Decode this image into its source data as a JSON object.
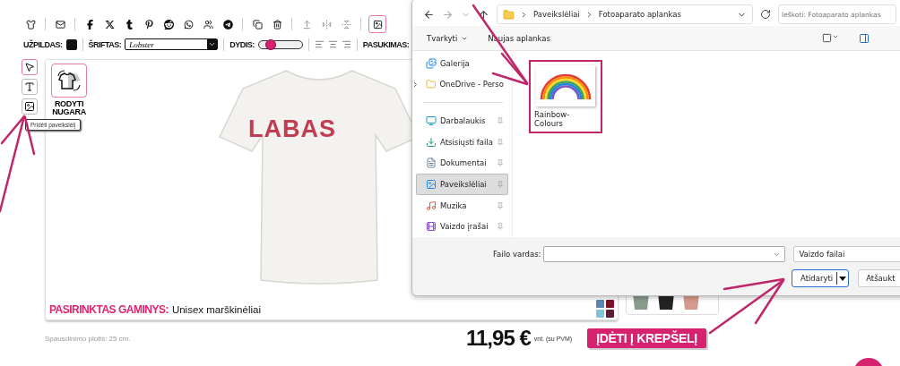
{
  "toolbar": {
    "groups": [
      {
        "items": [
          {
            "selected": false
          }
        ]
      },
      {
        "items": [
          {
            "selected": false
          }
        ]
      },
      {
        "items": [
          {
            "selected": false
          },
          {
            "selected": false
          },
          {
            "selected": false
          },
          {
            "selected": false
          },
          {
            "selected": false
          },
          {
            "selected": false
          },
          {
            "selected": false
          },
          {
            "selected": false
          }
        ]
      },
      {
        "items": [
          {
            "selected": false
          },
          {
            "selected": false
          }
        ]
      },
      {
        "items": [
          {
            "selected": false
          },
          {
            "selected": false
          },
          {
            "selected": false
          }
        ]
      },
      {
        "items": [
          {
            "selected": true
          }
        ]
      }
    ]
  },
  "properties": {
    "fill_label": "UŽPILDAS:",
    "font_label": "ŠRIFTAS:",
    "font_value": "Lobster",
    "size_label": "DYDIS:",
    "size_slider": {
      "level": 0.27
    },
    "rotation_label": "PASUKIMAS:"
  },
  "tools": [
    {
      "selected": true
    },
    {
      "selected": false
    },
    {
      "selected": false
    }
  ],
  "tooltip": "Pridėti paveikslėlį",
  "show_back": {
    "label": "RODYTI NUGARA"
  },
  "shirt_print": "LABAS",
  "selected_product": {
    "label": "PASIRINKTAS GAMINYS:",
    "value": "Unisex marškinėliai"
  },
  "swatches": [
    {
      "color": "#5b86b8"
    },
    {
      "color": "#7a1028"
    },
    {
      "color": "#7ec3d8"
    },
    {
      "color": "#5a1f35"
    }
  ],
  "print_width": "Spausdinimo plotis: 25 cm.",
  "price": "11,95 €",
  "price_note": "vnt. (su PVM)",
  "add_to_cart": "ĮDĖTI Į KREPŠELĮ",
  "dialog": {
    "path": [
      "Paveikslėliai",
      "Fotoaparato aplankas"
    ],
    "search_placeholder": "Ieškoti: Fotoaparato aplankas",
    "commands": [
      {
        "label": "Tvarkyti",
        "dropdown": true
      },
      {
        "label": "Naujas aplankas",
        "dropdown": false
      }
    ],
    "nav_top": [
      {
        "label": "Galerija",
        "expandable": false
      },
      {
        "label": "OneDrive - Perso",
        "expandable": true
      }
    ],
    "nav_pinned": [
      {
        "label": "Darbalaukis",
        "selected": false
      },
      {
        "label": "Atsisiųsti faila",
        "selected": false
      },
      {
        "label": "Dokumentai",
        "selected": false
      },
      {
        "label": "Paveikslėliai",
        "selected": true
      },
      {
        "label": "Muzika",
        "selected": false
      },
      {
        "label": "Vaizdo įrašai",
        "selected": false
      }
    ],
    "files": [
      {
        "name": "Rainbow-Colours",
        "highlighted": true
      }
    ],
    "filename_label": "Failo vardas:",
    "file_type": "Vaizdo failai",
    "open_button": "Atidaryti",
    "cancel_button": "Atšaukt"
  }
}
